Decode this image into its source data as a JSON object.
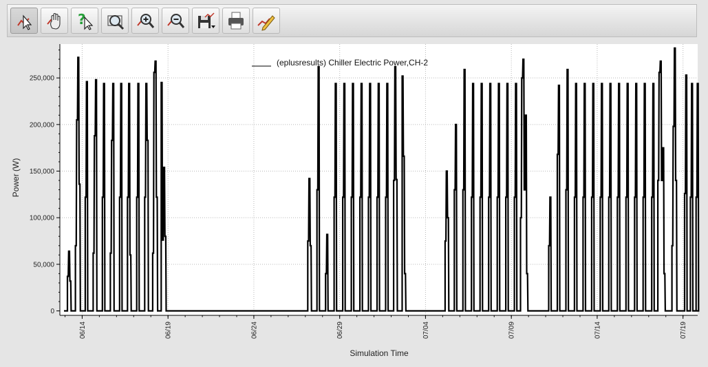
{
  "toolbar": {
    "buttons": [
      {
        "icon": "select-pointer-icon",
        "active": true
      },
      {
        "icon": "pan-hand-icon",
        "active": false
      },
      {
        "icon": "help-pointer-icon",
        "active": false
      },
      {
        "icon": "zoom-fit-icon",
        "active": false
      },
      {
        "icon": "zoom-in-icon",
        "active": false
      },
      {
        "icon": "zoom-out-icon",
        "active": false
      },
      {
        "icon": "save-disk-icon",
        "active": false
      },
      {
        "icon": "print-icon",
        "active": false
      },
      {
        "icon": "edit-chart-icon",
        "active": false
      }
    ]
  },
  "chart_data": {
    "type": "line",
    "legend": "(eplusresults) Chiller Electric Power,CH-2",
    "legend_position": "top-center",
    "xlabel": "Simulation Time",
    "ylabel": "Power (W)",
    "ylim": [
      0,
      285000
    ],
    "xlim_days": [
      12.7,
      20.2
    ],
    "y_ticks": [
      {
        "v": 0,
        "label": "0"
      },
      {
        "v": 50000,
        "label": "50,000"
      },
      {
        "v": 100000,
        "label": "100,000"
      },
      {
        "v": 150000,
        "label": "150,000"
      },
      {
        "v": 200000,
        "label": "200,000"
      },
      {
        "v": 250000,
        "label": "250,000"
      }
    ],
    "x_ticks": [
      "06/14",
      "06/19",
      "06/24",
      "06/29",
      "07/04",
      "07/09",
      "07/14",
      "07/19"
    ],
    "grid": true,
    "line_color": "#000000",
    "pulses": [
      {
        "date": "06/13",
        "peaks": [
          37000,
          64000,
          32000
        ]
      },
      {
        "date": "06/13",
        "peaks": [
          70000,
          205000,
          272000,
          136000
        ]
      },
      {
        "date": "06/14",
        "peaks": [
          122000,
          246000
        ]
      },
      {
        "date": "06/14",
        "peaks": [
          62000,
          188000,
          248000
        ]
      },
      {
        "date": "06/15",
        "peaks": [
          122000,
          244000
        ]
      },
      {
        "date": "06/15",
        "peaks": [
          62000,
          183000,
          244000
        ]
      },
      {
        "date": "06/16",
        "peaks": [
          122000,
          244000
        ]
      },
      {
        "date": "06/16",
        "peaks": [
          122000,
          244000,
          60000
        ]
      },
      {
        "date": "06/17",
        "peaks": [
          122000,
          244000
        ]
      },
      {
        "date": "06/17",
        "peaks": [
          122000,
          244000,
          183000
        ]
      },
      {
        "date": "06/18",
        "peaks": [
          62000,
          256000,
          268000,
          122000
        ]
      },
      {
        "date": "06/18",
        "peaks": [
          245000,
          76000,
          154000,
          80000
        ]
      },
      {
        "date": "06/27",
        "peaks": [
          75000,
          142000,
          70000
        ]
      },
      {
        "date": "06/27",
        "peaks": [
          130000,
          262000
        ]
      },
      {
        "date": "06/28",
        "peaks": [
          40000,
          82000
        ]
      },
      {
        "date": "06/28",
        "peaks": [
          122000,
          244000
        ]
      },
      {
        "date": "06/29",
        "peaks": [
          122000,
          244000
        ]
      },
      {
        "date": "06/29",
        "peaks": [
          122000,
          244000
        ]
      },
      {
        "date": "06/30",
        "peaks": [
          122000,
          244000
        ]
      },
      {
        "date": "06/30",
        "peaks": [
          122000,
          244000
        ]
      },
      {
        "date": "07/01",
        "peaks": [
          122000,
          244000
        ]
      },
      {
        "date": "07/01",
        "peaks": [
          122000,
          244000
        ]
      },
      {
        "date": "07/02",
        "peaks": [
          140000,
          262000,
          141000
        ]
      },
      {
        "date": "07/02",
        "peaks": [
          252000,
          166000,
          40000
        ]
      },
      {
        "date": "07/05",
        "peaks": [
          75000,
          150000,
          100000
        ]
      },
      {
        "date": "07/05",
        "peaks": [
          130000,
          200000
        ]
      },
      {
        "date": "07/06",
        "peaks": [
          130000,
          259000
        ]
      },
      {
        "date": "07/06",
        "peaks": [
          122000,
          244000
        ]
      },
      {
        "date": "07/07",
        "peaks": [
          122000,
          244000
        ]
      },
      {
        "date": "07/07",
        "peaks": [
          122000,
          244000
        ]
      },
      {
        "date": "07/08",
        "peaks": [
          122000,
          244000
        ]
      },
      {
        "date": "07/08",
        "peaks": [
          122000,
          244000
        ]
      },
      {
        "date": "07/09",
        "peaks": [
          122000,
          244000
        ]
      },
      {
        "date": "07/09",
        "peaks": [
          100000,
          250000,
          270000,
          130000,
          210000,
          40000
        ]
      },
      {
        "date": "07/11",
        "peaks": [
          70000,
          122000
        ]
      },
      {
        "date": "07/11",
        "peaks": [
          168000,
          242000
        ]
      },
      {
        "date": "07/12",
        "peaks": [
          130000,
          259000
        ]
      },
      {
        "date": "07/12",
        "peaks": [
          122000,
          244000
        ]
      },
      {
        "date": "07/13",
        "peaks": [
          122000,
          244000
        ]
      },
      {
        "date": "07/13",
        "peaks": [
          122000,
          244000
        ]
      },
      {
        "date": "07/14",
        "peaks": [
          122000,
          244000
        ]
      },
      {
        "date": "07/14",
        "peaks": [
          122000,
          244000
        ]
      },
      {
        "date": "07/15",
        "peaks": [
          122000,
          244000
        ]
      },
      {
        "date": "07/15",
        "peaks": [
          122000,
          244000
        ]
      },
      {
        "date": "07/16",
        "peaks": [
          122000,
          244000
        ]
      },
      {
        "date": "07/16",
        "peaks": [
          122000,
          244000
        ]
      },
      {
        "date": "07/17",
        "peaks": [
          122000,
          244000
        ]
      },
      {
        "date": "07/17",
        "peaks": [
          140000,
          256000,
          268000,
          140000,
          175000,
          40000
        ]
      },
      {
        "date": "07/18",
        "peaks": [
          70000,
          198000,
          282000,
          140000
        ]
      },
      {
        "date": "07/19",
        "peaks": [
          126000,
          253000
        ]
      },
      {
        "date": "07/19",
        "peaks": [
          122000,
          244000
        ]
      },
      {
        "date": "07/19",
        "peaks": [
          122000,
          244000
        ]
      }
    ]
  }
}
